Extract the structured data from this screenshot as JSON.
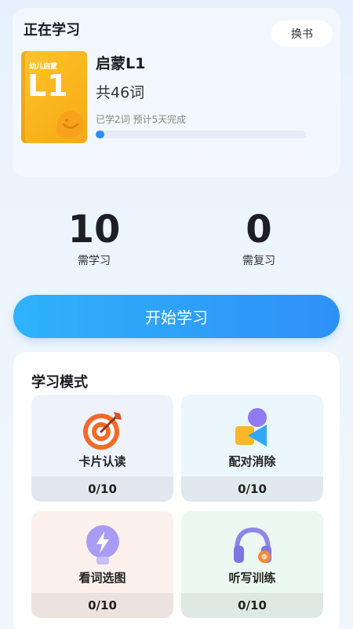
{
  "current": {
    "heading": "正在学习",
    "swap_label": "换书",
    "book_cover_sub": "幼儿启蒙",
    "book_cover_level": "L1",
    "book_name": "启蒙L1",
    "word_count": "共46词",
    "progress_text": "已学2词 预计5天完成",
    "progress_fraction": 0.04
  },
  "stats": {
    "to_learn": {
      "value": "10",
      "label": "需学习"
    },
    "to_review": {
      "value": "0",
      "label": "需复习"
    }
  },
  "start_button": "开始学习",
  "modes": {
    "title": "学习模式",
    "items": [
      {
        "name": "卡片认读",
        "progress": "0/10",
        "icon": "target-icon",
        "bg": "#eef3fb",
        "foot": "#e2e7ef"
      },
      {
        "name": "配对消除",
        "progress": "0/10",
        "icon": "shapes-icon",
        "bg": "#ebf6fd",
        "foot": "#dfe9ee"
      },
      {
        "name": "看词选图",
        "progress": "0/10",
        "icon": "bulb-icon",
        "bg": "#fdf1ee",
        "foot": "#ece3e0"
      },
      {
        "name": "听写训练",
        "progress": "0/10",
        "icon": "headphones-icon",
        "bg": "#ecf8f2",
        "foot": "#dfe9e4"
      }
    ]
  },
  "colors": {
    "accent": "#2e90f7",
    "book": "#f8a815"
  }
}
